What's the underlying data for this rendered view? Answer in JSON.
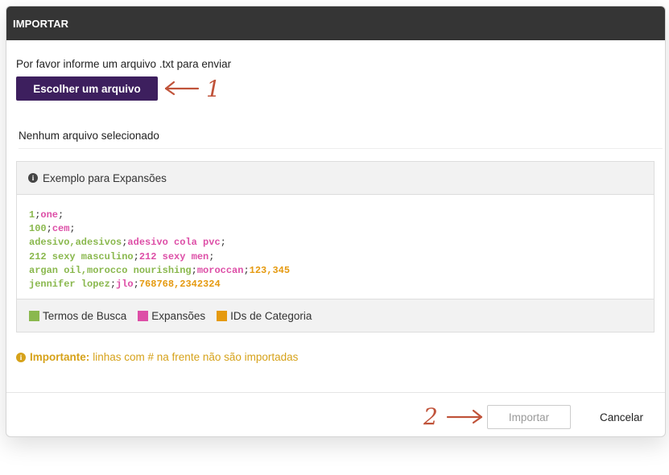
{
  "modal": {
    "title": "IMPORTAR"
  },
  "upload": {
    "instructions": "Por favor informe um arquivo .txt para enviar",
    "choose_label": "Escolher um arquivo",
    "file_status": "Nenhum arquivo selecionado"
  },
  "example": {
    "title": "Exemplo para Expansões",
    "lines": [
      {
        "terms": "1",
        "expansions": "one",
        "categories": ""
      },
      {
        "terms": "100",
        "expansions": "cem",
        "categories": ""
      },
      {
        "terms": "adesivo,adesivos",
        "expansions": "adesivo cola pvc",
        "categories": ""
      },
      {
        "terms": "212 sexy masculino",
        "expansions": "212 sexy men",
        "categories": ""
      },
      {
        "terms": "argan oil,morocco nourishing",
        "expansions": "moroccan",
        "categories": "123,345"
      },
      {
        "terms": "jennifer lopez",
        "expansions": "jlo",
        "categories": "768768,2342324"
      }
    ],
    "legend": [
      {
        "label": "Termos de Busca",
        "color": "#8ab84e"
      },
      {
        "label": "Expansões",
        "color": "#dd4fa7"
      },
      {
        "label": "IDs de Categoria",
        "color": "#e59a10"
      }
    ]
  },
  "important": {
    "label": "Importante:",
    "text": "linhas com # na frente não são importadas"
  },
  "footer": {
    "import_label": "Importar",
    "cancel_label": "Cancelar"
  },
  "annotations": {
    "arrow_1_number": "1",
    "arrow_2_number": "2",
    "color": "#c0533a"
  },
  "colors": {
    "header_bg": "#353535",
    "primary_button": "#3d1f5e",
    "important_text": "#d6a21a"
  },
  "icons": {
    "info": "info-circle-icon",
    "swatch": "legend-swatch"
  }
}
